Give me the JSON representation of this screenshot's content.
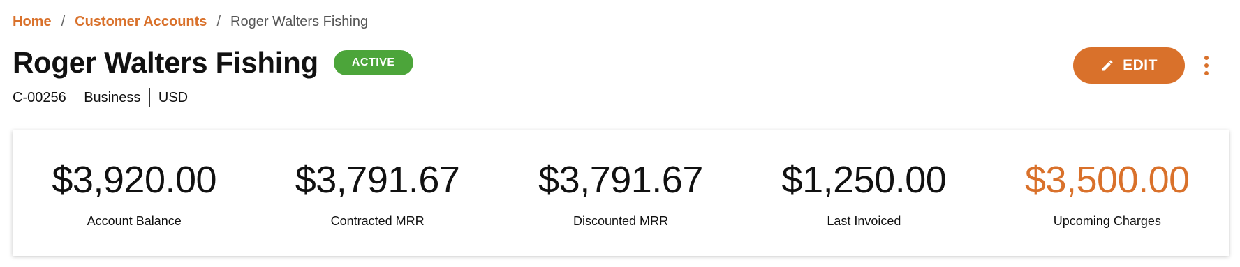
{
  "breadcrumb": {
    "items": [
      {
        "label": "Home"
      },
      {
        "label": "Customer Accounts"
      }
    ],
    "separator": "/",
    "current": "Roger Walters Fishing"
  },
  "header": {
    "title": "Roger Walters Fishing",
    "status": "ACTIVE",
    "status_color": "#4ca53a",
    "meta": [
      "C-00256",
      "Business",
      "USD"
    ]
  },
  "actions": {
    "edit_label": "EDIT",
    "edit_icon": "pencil-icon",
    "more_icon": "more-vertical-icon",
    "accent_color": "#d9712b"
  },
  "metrics": [
    {
      "value": "$3,920.00",
      "label": "Account Balance"
    },
    {
      "value": "$3,791.67",
      "label": "Contracted MRR"
    },
    {
      "value": "$3,791.67",
      "label": "Discounted MRR"
    },
    {
      "value": "$1,250.00",
      "label": "Last Invoiced"
    },
    {
      "value": "$3,500.00",
      "label": "Upcoming Charges",
      "highlight": true
    }
  ]
}
